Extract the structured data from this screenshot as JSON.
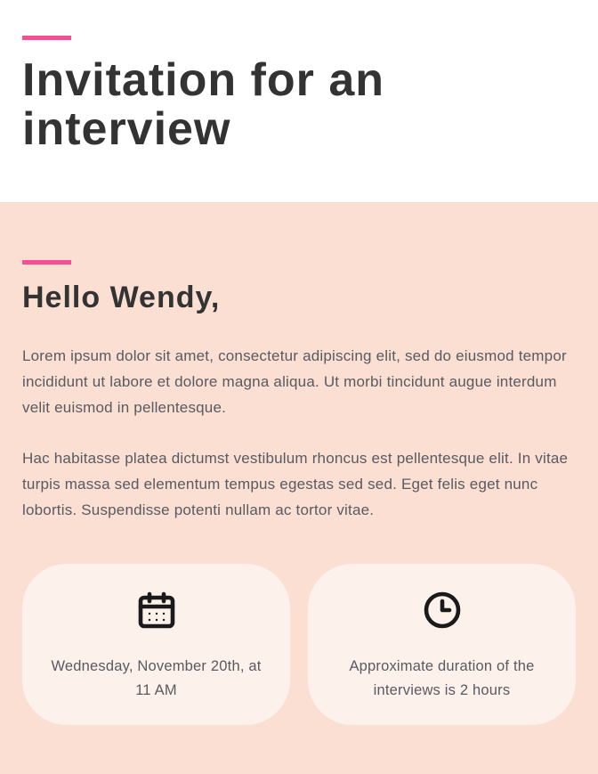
{
  "header": {
    "title": "Invitation for an interview"
  },
  "body": {
    "greeting": "Hello Wendy,",
    "paragraph1": "Lorem ipsum dolor sit amet, consectetur adipiscing elit, sed do eiusmod tempor incididunt ut labore et dolore magna aliqua. Ut morbi tincidunt augue interdum velit euismod in pellentesque.",
    "paragraph2": "Hac habitasse platea dictumst vestibulum rhoncus est pellentesque elit. In vitae turpis massa sed elementum tempus egestas sed sed. Eget felis eget nunc lobortis. Suspendisse potenti nullam ac tortor vitae."
  },
  "cards": {
    "date": "Wednesday, November 20th, at 11 AM",
    "duration": "Approximate duration of the interviews is 2 hours"
  },
  "colors": {
    "accent": "#f55095",
    "bodyBg": "#fadfd2",
    "cardBg": "#fcf1eb",
    "heading": "#333333",
    "text": "#595a62"
  }
}
